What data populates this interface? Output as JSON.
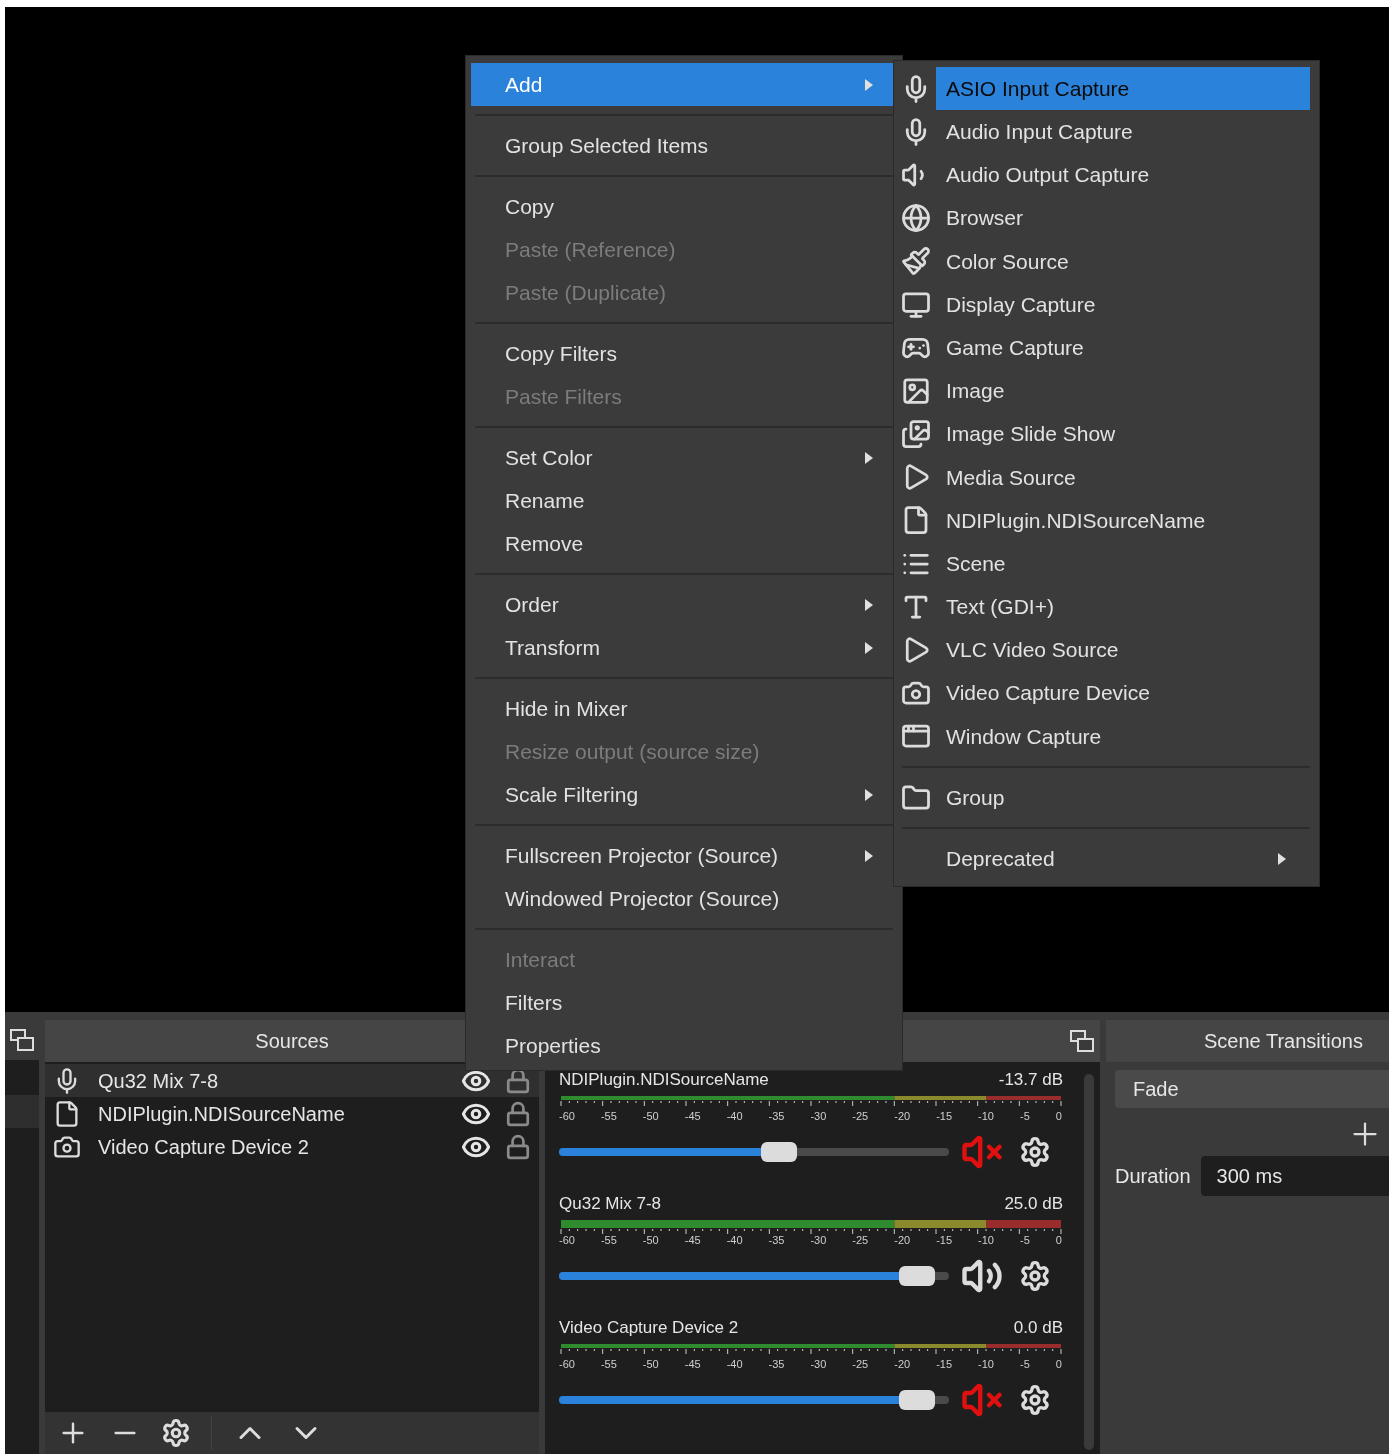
{
  "context_menu": {
    "items": [
      {
        "kind": "item",
        "label": "Add",
        "selected": true,
        "disabled": false,
        "submenu": true
      },
      {
        "kind": "separator"
      },
      {
        "kind": "item",
        "label": "Group Selected Items",
        "selected": false,
        "disabled": false,
        "submenu": false
      },
      {
        "kind": "separator"
      },
      {
        "kind": "item",
        "label": "Copy",
        "selected": false,
        "disabled": false,
        "submenu": false
      },
      {
        "kind": "item",
        "label": "Paste (Reference)",
        "selected": false,
        "disabled": true,
        "submenu": false
      },
      {
        "kind": "item",
        "label": "Paste (Duplicate)",
        "selected": false,
        "disabled": true,
        "submenu": false
      },
      {
        "kind": "separator"
      },
      {
        "kind": "item",
        "label": "Copy Filters",
        "selected": false,
        "disabled": false,
        "submenu": false
      },
      {
        "kind": "item",
        "label": "Paste Filters",
        "selected": false,
        "disabled": true,
        "submenu": false
      },
      {
        "kind": "separator"
      },
      {
        "kind": "item",
        "label": "Set Color",
        "selected": false,
        "disabled": false,
        "submenu": true
      },
      {
        "kind": "item",
        "label": "Rename",
        "selected": false,
        "disabled": false,
        "submenu": false
      },
      {
        "kind": "item",
        "label": "Remove",
        "selected": false,
        "disabled": false,
        "submenu": false
      },
      {
        "kind": "separator"
      },
      {
        "kind": "item",
        "label": "Order",
        "selected": false,
        "disabled": false,
        "submenu": true
      },
      {
        "kind": "item",
        "label": "Transform",
        "selected": false,
        "disabled": false,
        "submenu": true
      },
      {
        "kind": "separator"
      },
      {
        "kind": "item",
        "label": "Hide in Mixer",
        "selected": false,
        "disabled": false,
        "submenu": false
      },
      {
        "kind": "item",
        "label": "Resize output (source size)",
        "selected": false,
        "disabled": true,
        "submenu": false
      },
      {
        "kind": "item",
        "label": "Scale Filtering",
        "selected": false,
        "disabled": false,
        "submenu": true
      },
      {
        "kind": "separator"
      },
      {
        "kind": "item",
        "label": "Fullscreen Projector (Source)",
        "selected": false,
        "disabled": false,
        "submenu": true
      },
      {
        "kind": "item",
        "label": "Windowed Projector (Source)",
        "selected": false,
        "disabled": false,
        "submenu": false
      },
      {
        "kind": "separator"
      },
      {
        "kind": "item",
        "label": "Interact",
        "selected": false,
        "disabled": true,
        "submenu": false
      },
      {
        "kind": "item",
        "label": "Filters",
        "selected": false,
        "disabled": false,
        "submenu": false
      },
      {
        "kind": "item",
        "label": "Properties",
        "selected": false,
        "disabled": false,
        "submenu": false
      }
    ]
  },
  "add_submenu": {
    "items": [
      {
        "kind": "item",
        "label": "ASIO Input Capture",
        "selected": true,
        "submenu": false
      },
      {
        "kind": "item",
        "label": "Audio Input Capture",
        "selected": false,
        "submenu": false
      },
      {
        "kind": "item",
        "label": "Audio Output Capture",
        "selected": false,
        "submenu": false
      },
      {
        "kind": "item",
        "label": "Browser",
        "selected": false,
        "submenu": false
      },
      {
        "kind": "item",
        "label": "Color Source",
        "selected": false,
        "submenu": false
      },
      {
        "kind": "item",
        "label": "Display Capture",
        "selected": false,
        "submenu": false
      },
      {
        "kind": "item",
        "label": "Game Capture",
        "selected": false,
        "submenu": false
      },
      {
        "kind": "item",
        "label": "Image",
        "selected": false,
        "submenu": false
      },
      {
        "kind": "item",
        "label": "Image Slide Show",
        "selected": false,
        "submenu": false
      },
      {
        "kind": "item",
        "label": "Media Source",
        "selected": false,
        "submenu": false
      },
      {
        "kind": "item",
        "label": "NDIPlugin.NDISourceName",
        "selected": false,
        "submenu": false
      },
      {
        "kind": "item",
        "label": "Scene",
        "selected": false,
        "submenu": false
      },
      {
        "kind": "item",
        "label": "Text (GDI+)",
        "selected": false,
        "submenu": false
      },
      {
        "kind": "item",
        "label": "VLC Video Source",
        "selected": false,
        "submenu": false
      },
      {
        "kind": "item",
        "label": "Video Capture Device",
        "selected": false,
        "submenu": false
      },
      {
        "kind": "item",
        "label": "Window Capture",
        "selected": false,
        "submenu": false
      },
      {
        "kind": "separator"
      },
      {
        "kind": "item",
        "label": "Group",
        "selected": false,
        "submenu": false
      },
      {
        "kind": "separator"
      },
      {
        "kind": "item",
        "label": "Deprecated",
        "selected": false,
        "submenu": true
      }
    ]
  },
  "sources": {
    "title": "Sources",
    "items": [
      {
        "name": "Qu32 Mix 7-8",
        "selected": true,
        "visible": true
      },
      {
        "name": "NDIPlugin.NDISourceName",
        "selected": false,
        "visible": true
      },
      {
        "name": "Video Capture Device 2",
        "selected": false,
        "visible": true
      }
    ]
  },
  "mixer": {
    "channels": [
      {
        "name": "NDIPlugin.NDISourceName",
        "reading": "-13.7 dB",
        "kind": "mono",
        "level": 0.57,
        "muted": true,
        "scale": [
          "-60",
          "-55",
          "-50",
          "-45",
          "-40",
          "-35",
          "-30",
          "-25",
          "-20",
          "-15",
          "-10",
          "-5",
          "0"
        ]
      },
      {
        "name": "Qu32 Mix 7-8",
        "reading": "25.0 dB",
        "kind": "stereo",
        "level": 0.96,
        "muted": false,
        "scale": [
          "-60",
          "-55",
          "-50",
          "-45",
          "-40",
          "-35",
          "-30",
          "-25",
          "-20",
          "-15",
          "-10",
          "-5",
          "0"
        ]
      },
      {
        "name": "Video Capture Device 2",
        "reading": "0.0 dB",
        "kind": "mono",
        "level": 0.96,
        "muted": true,
        "scale": [
          "-60",
          "-55",
          "-50",
          "-45",
          "-40",
          "-35",
          "-30",
          "-25",
          "-20",
          "-15",
          "-10",
          "-5",
          "0"
        ]
      }
    ]
  },
  "scene_transitions": {
    "title": "Scene Transitions",
    "transition": "Fade",
    "duration_label": "Duration",
    "duration": "300 ms"
  }
}
